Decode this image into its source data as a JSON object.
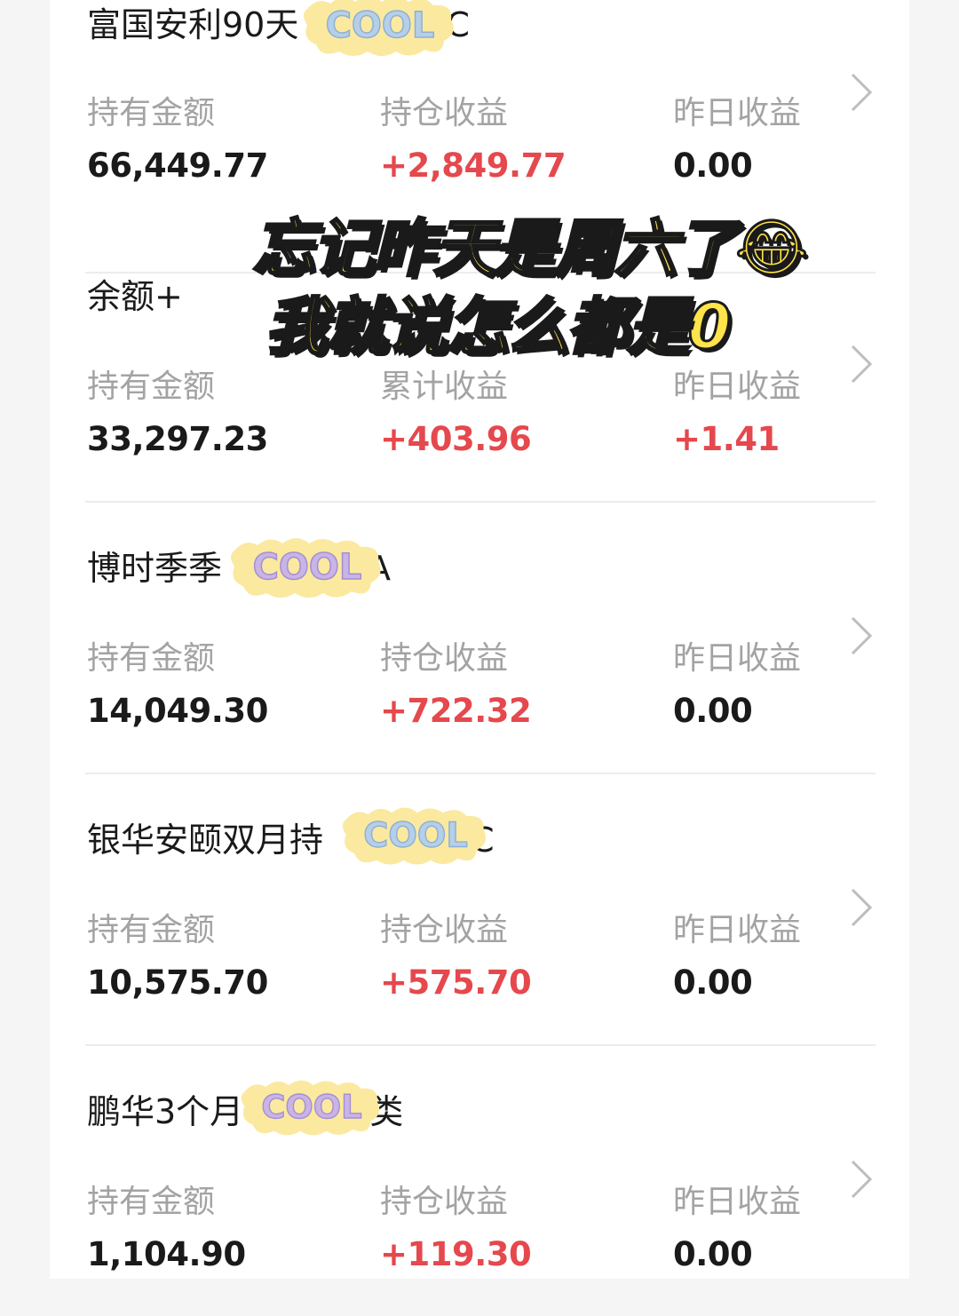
{
  "funds": [
    {
      "name": "富国安利90天",
      "name_suffix": "C",
      "labels": [
        "持有金额",
        "持仓收益",
        "昨日收益"
      ],
      "values": [
        "66,449.77",
        "+2,849.77",
        "0.00"
      ],
      "positive": [
        false,
        true,
        false
      ]
    },
    {
      "name": "余额+",
      "name_suffix": "",
      "labels": [
        "持有金额",
        "累计收益",
        "昨日收益"
      ],
      "values": [
        "33,297.23",
        "+403.96",
        "+1.41"
      ],
      "positive": [
        false,
        true,
        true
      ]
    },
    {
      "name": "博时季季",
      "name_suffix": "A",
      "labels": [
        "持有金额",
        "持仓收益",
        "昨日收益"
      ],
      "values": [
        "14,049.30",
        "+722.32",
        "0.00"
      ],
      "positive": [
        false,
        true,
        false
      ]
    },
    {
      "name": "银华安颐双月持",
      "name_suffix": "C",
      "labels": [
        "持有金额",
        "持仓收益",
        "昨日收益"
      ],
      "values": [
        "10,575.70",
        "+575.70",
        "0.00"
      ],
      "positive": [
        false,
        true,
        false
      ]
    },
    {
      "name": "鹏华3个月",
      "name_suffix": "类",
      "labels": [
        "持有金额",
        "持仓收益",
        "昨日收益"
      ],
      "values": [
        "1,104.90",
        "+119.30",
        "0.00"
      ],
      "positive": [
        false,
        true,
        false
      ]
    }
  ],
  "caption": {
    "line1": "忘记昨天是周六了😂",
    "line2": "我就说怎么都是0"
  },
  "sticker_text": "COOL",
  "colors": {
    "positive": "#e5484d",
    "label": "#a3a3a3",
    "text": "#1a1a1a",
    "caption": "#ffe34a"
  }
}
